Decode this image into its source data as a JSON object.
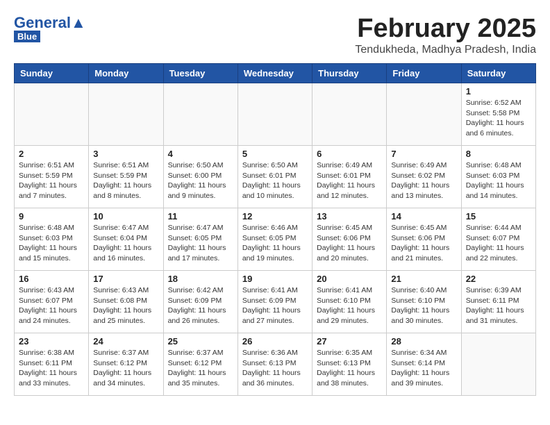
{
  "logo": {
    "general": "General",
    "blue": "Blue"
  },
  "title": "February 2025",
  "location": "Tendukheda, Madhya Pradesh, India",
  "weekdays": [
    "Sunday",
    "Monday",
    "Tuesday",
    "Wednesday",
    "Thursday",
    "Friday",
    "Saturday"
  ],
  "weeks": [
    [
      {
        "day": "",
        "info": ""
      },
      {
        "day": "",
        "info": ""
      },
      {
        "day": "",
        "info": ""
      },
      {
        "day": "",
        "info": ""
      },
      {
        "day": "",
        "info": ""
      },
      {
        "day": "",
        "info": ""
      },
      {
        "day": "1",
        "info": "Sunrise: 6:52 AM\nSunset: 5:58 PM\nDaylight: 11 hours and 6 minutes."
      }
    ],
    [
      {
        "day": "2",
        "info": "Sunrise: 6:51 AM\nSunset: 5:59 PM\nDaylight: 11 hours and 7 minutes."
      },
      {
        "day": "3",
        "info": "Sunrise: 6:51 AM\nSunset: 5:59 PM\nDaylight: 11 hours and 8 minutes."
      },
      {
        "day": "4",
        "info": "Sunrise: 6:50 AM\nSunset: 6:00 PM\nDaylight: 11 hours and 9 minutes."
      },
      {
        "day": "5",
        "info": "Sunrise: 6:50 AM\nSunset: 6:01 PM\nDaylight: 11 hours and 10 minutes."
      },
      {
        "day": "6",
        "info": "Sunrise: 6:49 AM\nSunset: 6:01 PM\nDaylight: 11 hours and 12 minutes."
      },
      {
        "day": "7",
        "info": "Sunrise: 6:49 AM\nSunset: 6:02 PM\nDaylight: 11 hours and 13 minutes."
      },
      {
        "day": "8",
        "info": "Sunrise: 6:48 AM\nSunset: 6:03 PM\nDaylight: 11 hours and 14 minutes."
      }
    ],
    [
      {
        "day": "9",
        "info": "Sunrise: 6:48 AM\nSunset: 6:03 PM\nDaylight: 11 hours and 15 minutes."
      },
      {
        "day": "10",
        "info": "Sunrise: 6:47 AM\nSunset: 6:04 PM\nDaylight: 11 hours and 16 minutes."
      },
      {
        "day": "11",
        "info": "Sunrise: 6:47 AM\nSunset: 6:05 PM\nDaylight: 11 hours and 17 minutes."
      },
      {
        "day": "12",
        "info": "Sunrise: 6:46 AM\nSunset: 6:05 PM\nDaylight: 11 hours and 19 minutes."
      },
      {
        "day": "13",
        "info": "Sunrise: 6:45 AM\nSunset: 6:06 PM\nDaylight: 11 hours and 20 minutes."
      },
      {
        "day": "14",
        "info": "Sunrise: 6:45 AM\nSunset: 6:06 PM\nDaylight: 11 hours and 21 minutes."
      },
      {
        "day": "15",
        "info": "Sunrise: 6:44 AM\nSunset: 6:07 PM\nDaylight: 11 hours and 22 minutes."
      }
    ],
    [
      {
        "day": "16",
        "info": "Sunrise: 6:43 AM\nSunset: 6:07 PM\nDaylight: 11 hours and 24 minutes."
      },
      {
        "day": "17",
        "info": "Sunrise: 6:43 AM\nSunset: 6:08 PM\nDaylight: 11 hours and 25 minutes."
      },
      {
        "day": "18",
        "info": "Sunrise: 6:42 AM\nSunset: 6:09 PM\nDaylight: 11 hours and 26 minutes."
      },
      {
        "day": "19",
        "info": "Sunrise: 6:41 AM\nSunset: 6:09 PM\nDaylight: 11 hours and 27 minutes."
      },
      {
        "day": "20",
        "info": "Sunrise: 6:41 AM\nSunset: 6:10 PM\nDaylight: 11 hours and 29 minutes."
      },
      {
        "day": "21",
        "info": "Sunrise: 6:40 AM\nSunset: 6:10 PM\nDaylight: 11 hours and 30 minutes."
      },
      {
        "day": "22",
        "info": "Sunrise: 6:39 AM\nSunset: 6:11 PM\nDaylight: 11 hours and 31 minutes."
      }
    ],
    [
      {
        "day": "23",
        "info": "Sunrise: 6:38 AM\nSunset: 6:11 PM\nDaylight: 11 hours and 33 minutes."
      },
      {
        "day": "24",
        "info": "Sunrise: 6:37 AM\nSunset: 6:12 PM\nDaylight: 11 hours and 34 minutes."
      },
      {
        "day": "25",
        "info": "Sunrise: 6:37 AM\nSunset: 6:12 PM\nDaylight: 11 hours and 35 minutes."
      },
      {
        "day": "26",
        "info": "Sunrise: 6:36 AM\nSunset: 6:13 PM\nDaylight: 11 hours and 36 minutes."
      },
      {
        "day": "27",
        "info": "Sunrise: 6:35 AM\nSunset: 6:13 PM\nDaylight: 11 hours and 38 minutes."
      },
      {
        "day": "28",
        "info": "Sunrise: 6:34 AM\nSunset: 6:14 PM\nDaylight: 11 hours and 39 minutes."
      },
      {
        "day": "",
        "info": ""
      }
    ]
  ]
}
